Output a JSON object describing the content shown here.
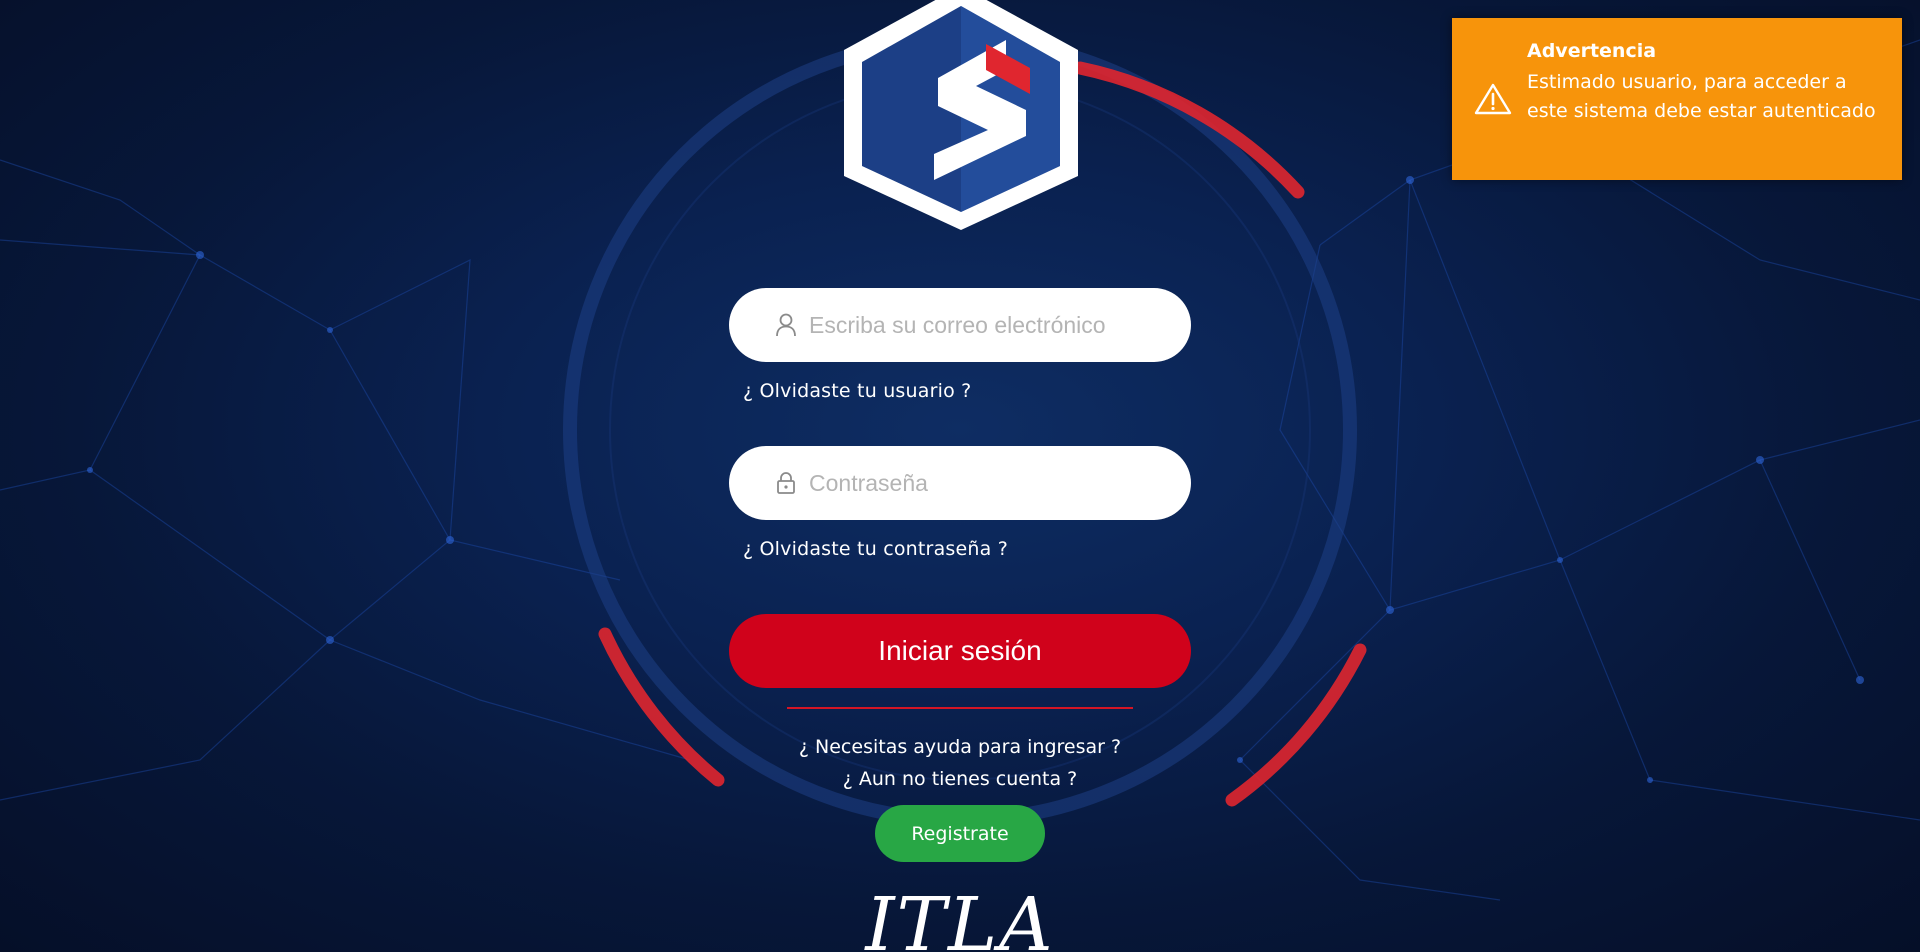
{
  "login": {
    "email_placeholder": "Escriba su correo electrónico",
    "email_icon": "user-icon",
    "forgot_user": "¿ Olvidaste tu usuario ?",
    "password_placeholder": "Contraseña",
    "password_icon": "lock-icon",
    "forgot_password": "¿ Olvidaste tu contraseña ?",
    "submit_label": "Iniciar sesión",
    "help_text": "¿ Necesitas ayuda para ingresar ?",
    "no_account_text": "¿ Aun no tienes cuenta ?",
    "register_label": "Registrate"
  },
  "brand": {
    "logo_icon": "shield-s-logo",
    "wordmark": "ITLA"
  },
  "toast": {
    "title": "Advertencia",
    "message": "Estimado usuario, para acceder a este sistema debe estar autenticado",
    "icon": "warning-icon"
  },
  "colors": {
    "background": "#0a2150",
    "login_button": "#d0021b",
    "register_button": "#28a745",
    "toast": "#f7940b",
    "accent_ring": "#e0262f"
  }
}
